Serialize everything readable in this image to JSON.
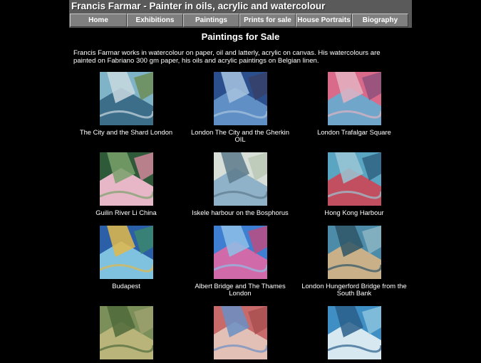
{
  "header": {
    "title": "Francis Farmar - Painter in oils, acrylic and watercolour",
    "nav": [
      {
        "label": "Home"
      },
      {
        "label": "Exhibitions"
      },
      {
        "label": "Paintings"
      },
      {
        "label": "Prints for sale"
      },
      {
        "label": "House Portraits"
      },
      {
        "label": "Biography"
      }
    ]
  },
  "main": {
    "heading": "Paintings for Sale",
    "intro": "Francis Farmar works in watercolour on paper, oil and latterly, acrylic on canvas. His watercolours are painted on Fabriano 300 gm paper, his oils and acrylic paintings on Belgian linen.",
    "paintings": [
      {
        "caption": "The City and the Shard London",
        "colors": [
          "#7fb3c8",
          "#3c6e8a",
          "#c9d9e0",
          "#6b8a4f"
        ]
      },
      {
        "caption": "London The City and the Gherkin OIL",
        "colors": [
          "#2b4f8c",
          "#5f8fc4",
          "#a8c4e0",
          "#3a3f66"
        ]
      },
      {
        "caption": "London Trafalgar Square",
        "colors": [
          "#d96a8a",
          "#6fa6c9",
          "#e3b3c2",
          "#8a4f7a"
        ]
      },
      {
        "caption": "Guilin River Li China",
        "colors": [
          "#2e5a3a",
          "#e8b7c7",
          "#79a16b",
          "#d98aa0"
        ]
      },
      {
        "caption": "Iskele harbour on the Bosphorus",
        "colors": [
          "#d7dfd8",
          "#8fb2c9",
          "#5d7a8c",
          "#b9c7b5"
        ]
      },
      {
        "caption": "Hong Kong Harbour",
        "colors": [
          "#5aa6c2",
          "#c24f5f",
          "#9ac7d6",
          "#2d5f80"
        ]
      },
      {
        "caption": "Budapest",
        "colors": [
          "#2b5fa8",
          "#7fc2e0",
          "#e2b84a",
          "#3c8a6a"
        ]
      },
      {
        "caption": "Albert Bridge and The Thames London",
        "colors": [
          "#3f7fd1",
          "#d16aa8",
          "#8ec0e8",
          "#c44a7a"
        ]
      },
      {
        "caption": "London Hungerford Bridge from the South Bank",
        "colors": [
          "#4d8ca8",
          "#c9b089",
          "#2f5566",
          "#8fb8c4"
        ]
      },
      {
        "caption": "",
        "colors": [
          "#7a8f5a",
          "#b9b47a",
          "#4f6a3a",
          "#a0a070"
        ]
      },
      {
        "caption": "",
        "colors": [
          "#c96a6a",
          "#e3c0b5",
          "#6a8fc4",
          "#a84f4f"
        ]
      },
      {
        "caption": "",
        "colors": [
          "#3f8fc4",
          "#d7e8f0",
          "#2a5f8a",
          "#8ec6e0"
        ]
      }
    ]
  }
}
